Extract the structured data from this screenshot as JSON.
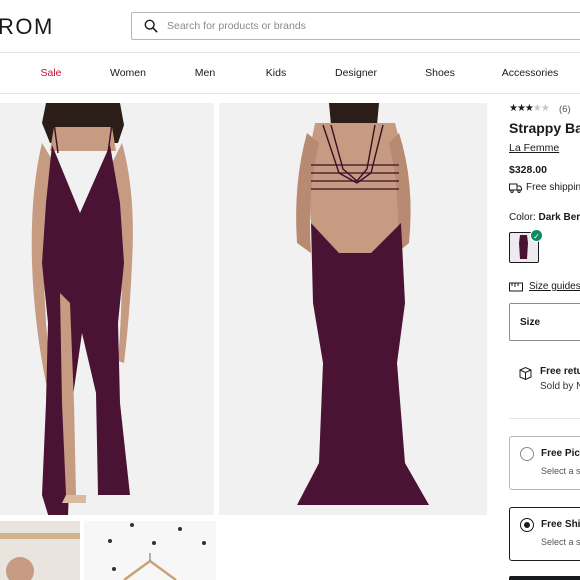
{
  "header": {
    "logo_text": "ROM",
    "search_placeholder": "Search for products or brands"
  },
  "nav": {
    "items": [
      "Sale",
      "Women",
      "Men",
      "Kids",
      "Designer",
      "Shoes",
      "Accessories"
    ]
  },
  "product": {
    "rating_stars": "★★★",
    "rating_empty": "★★",
    "review_count": "(6)",
    "title": "Strappy Bac",
    "brand": "La Femme",
    "price": "$328.00",
    "shipping": "Free shipping",
    "color_label": "Color:",
    "color_value": "Dark Berr",
    "size_guides": "Size guides",
    "size_label": "Size",
    "returns_title": "Free retu",
    "returns_sub": "Sold by N",
    "pickup_title": "Free Pick",
    "pickup_sub": "Select a siz",
    "shipto_title": "Free Ship",
    "shipto_sub": "Select a siz"
  },
  "colors": {
    "dress": "#4a1333",
    "sale": "#c41230",
    "check": "#0d8a5f"
  }
}
